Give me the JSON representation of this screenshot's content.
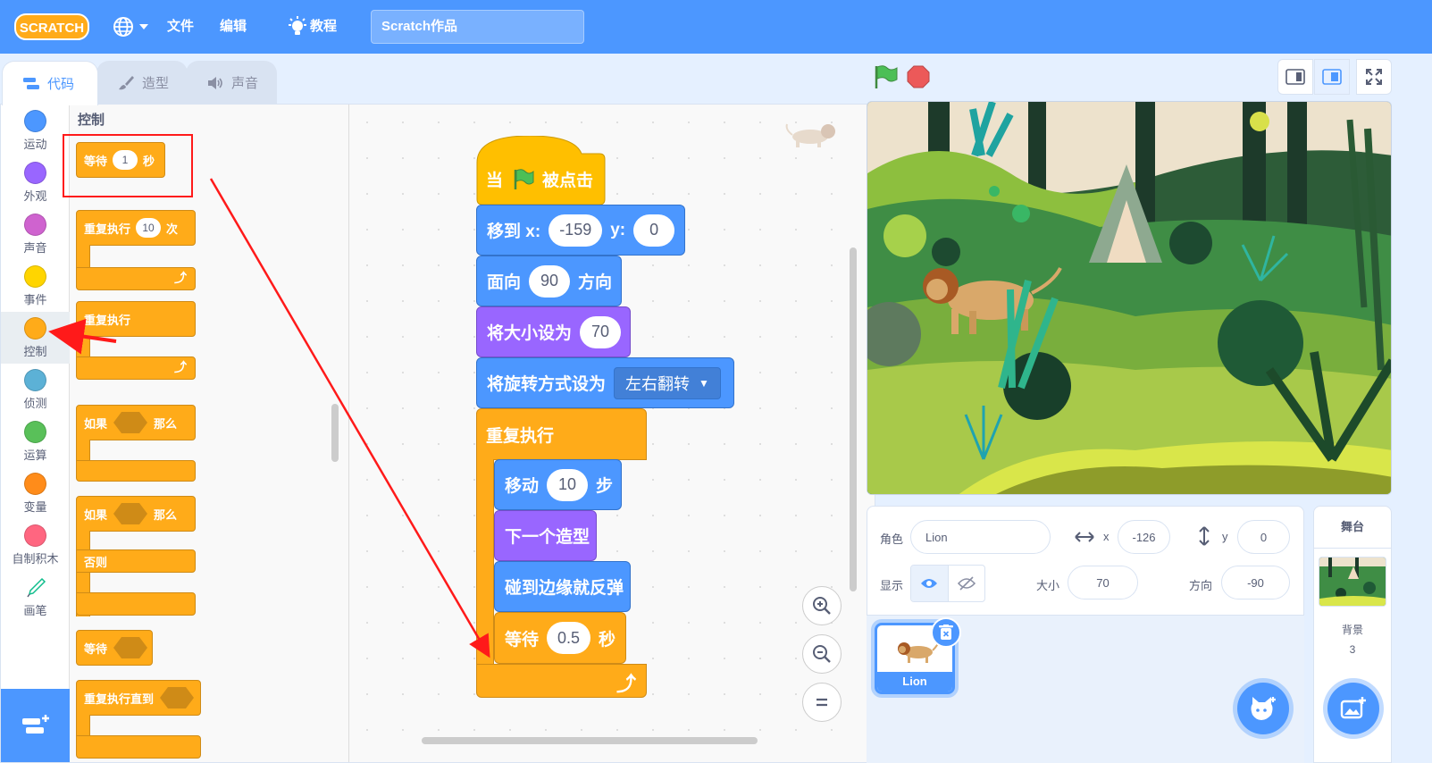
{
  "menubar": {
    "logo_text": "SCRATCH",
    "file": "文件",
    "edit": "编辑",
    "tutorials": "教程",
    "project_title": "Scratch作品"
  },
  "tabs": {
    "code": "代码",
    "costumes": "造型",
    "sounds": "声音"
  },
  "categories": [
    {
      "label": "运动",
      "color": "#4c97ff"
    },
    {
      "label": "外观",
      "color": "#9966ff"
    },
    {
      "label": "声音",
      "color": "#cf63cf"
    },
    {
      "label": "事件",
      "color": "#ffd500"
    },
    {
      "label": "控制",
      "color": "#ffab19"
    },
    {
      "label": "侦测",
      "color": "#5cb1d6"
    },
    {
      "label": "运算",
      "color": "#59c059"
    },
    {
      "label": "变量",
      "color": "#ff8c1a"
    },
    {
      "label": "自制积木",
      "color": "#ff6680"
    },
    {
      "label": "画笔",
      "color": ""
    }
  ],
  "palette": {
    "heading": "控制",
    "wait": {
      "pre": "等待",
      "value": "1",
      "post": "秒"
    },
    "repeat": {
      "pre": "重复执行",
      "value": "10",
      "post": "次"
    },
    "forever": "重复执行",
    "if_then": {
      "pre": "如果",
      "post": "那么"
    },
    "if_else": {
      "pre": "如果",
      "post": "那么",
      "else": "否则"
    },
    "wait_until": "等待",
    "repeat_until": "重复执行直到"
  },
  "script": {
    "hat": {
      "pre": "当",
      "post": "被点击"
    },
    "goto": {
      "pre": "移到 x:",
      "x": "-159",
      "mid": "y:",
      "y": "0"
    },
    "point": {
      "pre": "面向",
      "value": "90",
      "post": "方向"
    },
    "size": {
      "pre": "将大小设为",
      "value": "70"
    },
    "rotation": {
      "pre": "将旋转方式设为",
      "value": "左右翻转"
    },
    "forever": "重复执行",
    "move": {
      "pre": "移动",
      "value": "10",
      "post": "步"
    },
    "next_costume": "下一个造型",
    "bounce": "碰到边缘就反弹",
    "wait": {
      "pre": "等待",
      "value": "0.5",
      "post": "秒"
    }
  },
  "sprite_info": {
    "sprite_label": "角色",
    "sprite_name": "Lion",
    "x_label": "x",
    "x_value": "-126",
    "y_label": "y",
    "y_value": "0",
    "show_label": "显示",
    "size_label": "大小",
    "size_value": "70",
    "direction_label": "方向",
    "direction_value": "-90"
  },
  "sprites": [
    {
      "name": "Lion"
    }
  ],
  "stage_pane": {
    "title": "舞台",
    "backdrop_label": "背景",
    "backdrop_count": "3"
  },
  "colors": {
    "motion": "#4c97ff",
    "looks": "#9966ff",
    "control": "#ffab19",
    "menubar": "#4c97ff",
    "annotation": "#ff1a1a"
  }
}
